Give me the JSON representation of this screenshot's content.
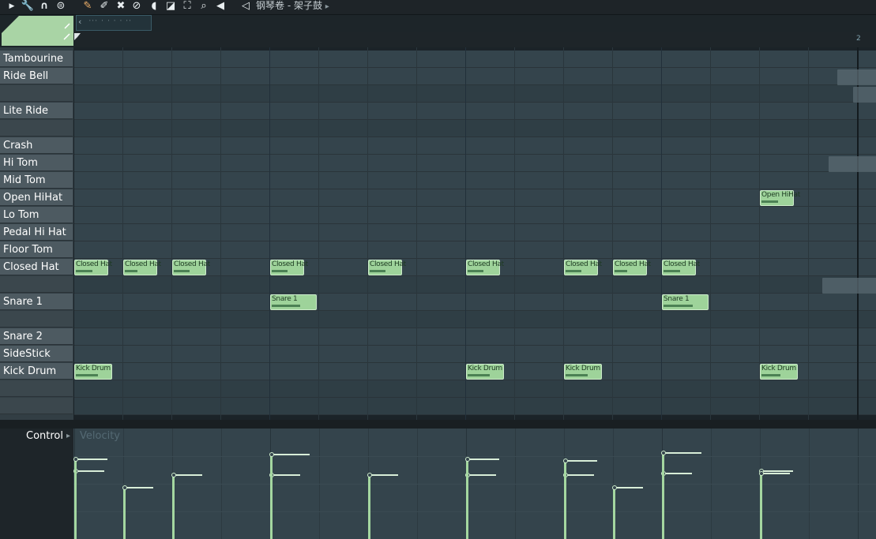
{
  "toolbar": {
    "icons": [
      "arrow-right-icon",
      "wrench-icon",
      "magnet-icon",
      "menu-circle-icon",
      "pencil-icon",
      "paint-brush-icon",
      "delete-icon",
      "mute-icon",
      "slice-icon",
      "select-icon",
      "zoom-icon",
      "play-icon"
    ],
    "title": "钢琴卷 - 架子鼓",
    "title_arrow": "▸"
  },
  "header": {
    "bar_number": "2"
  },
  "keys": [
    {
      "label": "Tambourine",
      "shade": "white"
    },
    {
      "label": "Ride Bell",
      "shade": "white"
    },
    {
      "label": "",
      "shade": "dark"
    },
    {
      "label": "Lite Ride",
      "shade": "white"
    },
    {
      "label": "",
      "shade": "dark"
    },
    {
      "label": "Crash",
      "shade": "white"
    },
    {
      "label": "Hi Tom",
      "shade": "white"
    },
    {
      "label": "Mid Tom",
      "shade": "white"
    },
    {
      "label": "Open HiHat",
      "shade": "white"
    },
    {
      "label": "Lo Tom",
      "shade": "white"
    },
    {
      "label": "Pedal Hi Hat",
      "shade": "white"
    },
    {
      "label": "Floor Tom",
      "shade": "white"
    },
    {
      "label": "Closed Hat",
      "shade": "white"
    },
    {
      "label": "",
      "shade": "dark"
    },
    {
      "label": "Snare 1",
      "shade": "white"
    },
    {
      "label": "",
      "shade": "dark"
    },
    {
      "label": "Snare 2",
      "shade": "white"
    },
    {
      "label": "SideStick",
      "shade": "white"
    },
    {
      "label": "Kick Drum",
      "shade": "white"
    },
    {
      "label": "",
      "shade": "dark"
    },
    {
      "label": "",
      "shade": "dark"
    }
  ],
  "notes": [
    {
      "label": "Closed Hat",
      "row": 12,
      "step": 0,
      "len": 0.7,
      "vel": 0.66
    },
    {
      "label": "Closed Hat",
      "row": 12,
      "step": 1,
      "len": 0.7,
      "vel": 0.5
    },
    {
      "label": "Closed Hat",
      "row": 12,
      "step": 2,
      "len": 0.7,
      "vel": 0.62
    },
    {
      "label": "Closed Hat",
      "row": 12,
      "step": 4,
      "len": 0.7,
      "vel": 0.62
    },
    {
      "label": "Closed Hat",
      "row": 12,
      "step": 6,
      "len": 0.7,
      "vel": 0.62
    },
    {
      "label": "Closed Hat",
      "row": 12,
      "step": 8,
      "len": 0.7,
      "vel": 0.62
    },
    {
      "label": "Closed Hat",
      "row": 12,
      "step": 10,
      "len": 0.7,
      "vel": 0.62
    },
    {
      "label": "Closed Hat",
      "row": 12,
      "step": 11,
      "len": 0.7,
      "vel": 0.5
    },
    {
      "label": "Closed Hat",
      "row": 12,
      "step": 12,
      "len": 0.7,
      "vel": 0.64
    },
    {
      "label": "Snare 1",
      "row": 14,
      "step": 4,
      "len": 0.95,
      "vel": 0.82
    },
    {
      "label": "Snare 1",
      "row": 14,
      "step": 12,
      "len": 0.95,
      "vel": 0.84
    },
    {
      "label": "Kick Drum",
      "row": 18,
      "step": 0,
      "len": 0.78,
      "vel": 0.78
    },
    {
      "label": "Kick Drum",
      "row": 18,
      "step": 8,
      "len": 0.78,
      "vel": 0.78
    },
    {
      "label": "Kick Drum",
      "row": 18,
      "step": 10,
      "len": 0.78,
      "vel": 0.76
    },
    {
      "label": "Kick Drum",
      "row": 18,
      "step": 14,
      "len": 0.78,
      "vel": 0.66
    },
    {
      "label": "Open HiHat",
      "row": 8,
      "step": 14,
      "len": 0.7,
      "vel": 0.64
    }
  ],
  "velocity": {
    "label": "Velocity",
    "control_label": "Control"
  }
}
